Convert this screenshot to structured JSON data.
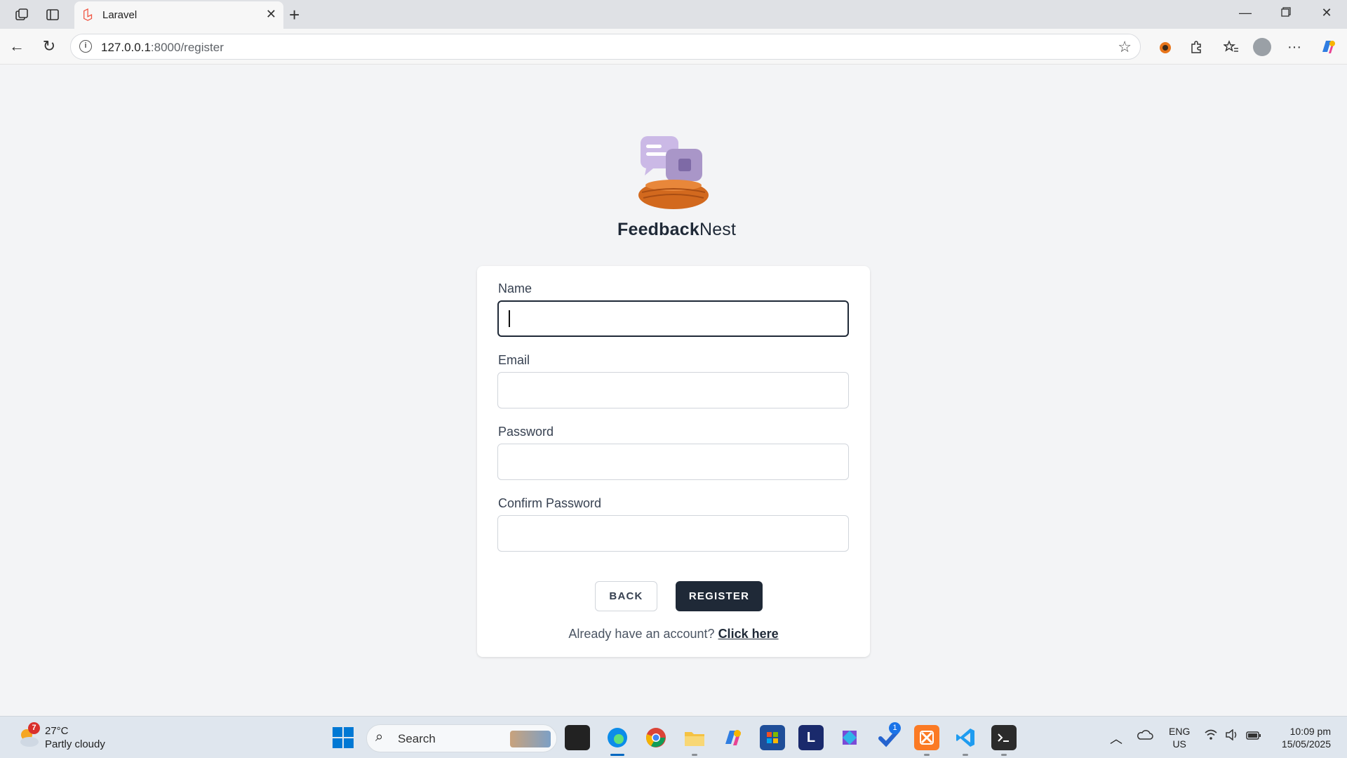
{
  "browser": {
    "tab_title": "Laravel",
    "url_host": "127.0.0.1",
    "url_path": ":8000/register"
  },
  "brand": {
    "name_bold": "Feedback",
    "name_regular": "Nest"
  },
  "form": {
    "name_label": "Name",
    "email_label": "Email",
    "password_label": "Password",
    "confirm_label": "Confirm Password",
    "back_label": "BACK",
    "register_label": "REGISTER",
    "already_text": "Already have an account?",
    "login_link": "Click here"
  },
  "taskbar": {
    "weather_badge": "7",
    "temperature": "27°C",
    "condition": "Partly cloudy",
    "search_placeholder": "Search",
    "todo_badge": "1",
    "lang_1": "ENG",
    "lang_2": "US",
    "time": "10:09 pm",
    "date": "15/05/2025"
  },
  "colors": {
    "primary_button": "#1f2937",
    "page_bg": "#f3f4f6",
    "nest_orange": "#d2691e",
    "bubble_purple": "#b9a7d6"
  },
  "icons": [
    "workspaces-icon",
    "vertical-tabs-icon",
    "laravel-icon",
    "close-tab-icon",
    "new-tab-icon",
    "minimize-icon",
    "restore-icon",
    "close-window-icon",
    "back-icon",
    "refresh-icon",
    "info-icon",
    "favorite-star-icon",
    "extension-icon",
    "puzzle-icon",
    "favorites-icon",
    "profile-icon",
    "more-icon",
    "copilot-icon"
  ]
}
